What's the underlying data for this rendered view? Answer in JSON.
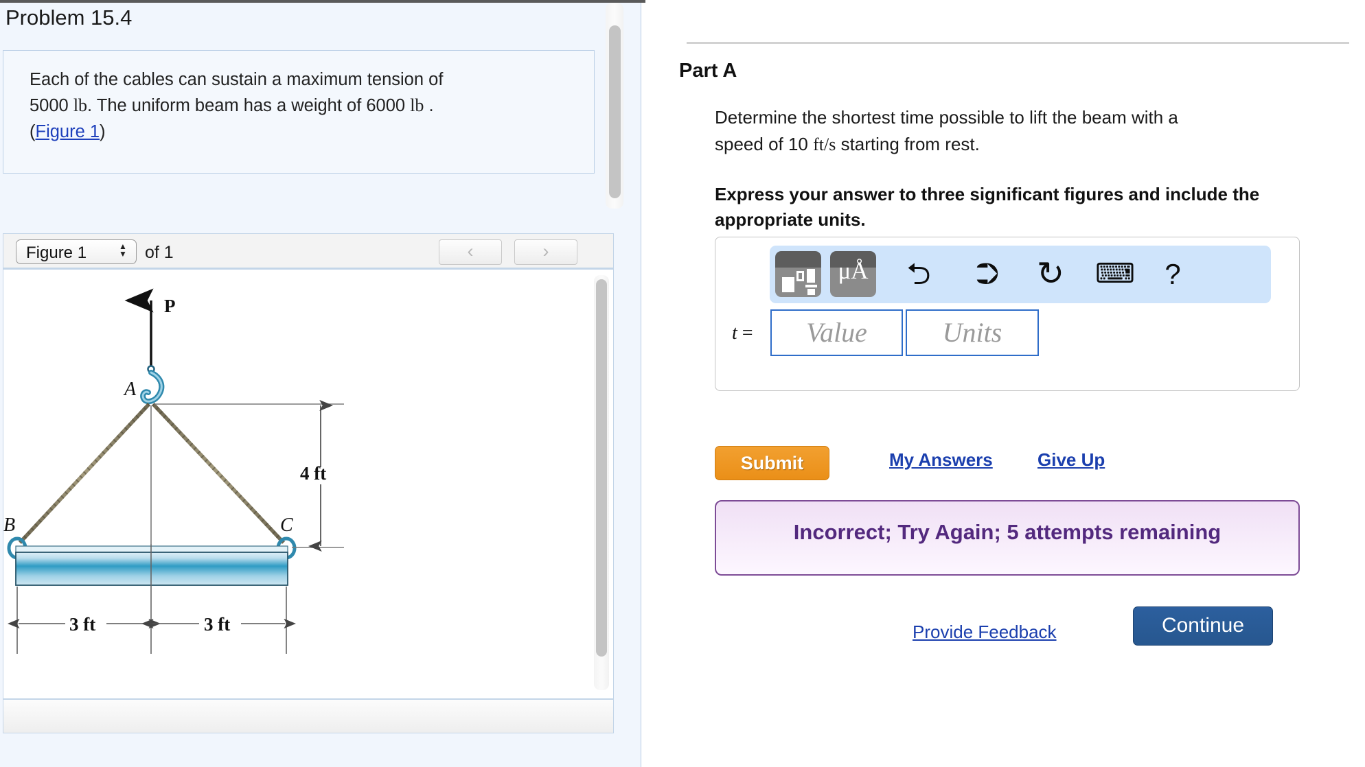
{
  "problem": {
    "title": "Problem 15.4",
    "statement_line1": "Each of the cables can sustain a maximum tension of",
    "statement_line2a": "5000 ",
    "statement_unit1": "lb",
    "statement_line2b": ". The uniform beam has a weight of 6000 ",
    "statement_unit2": "lb",
    "statement_line2c": " .",
    "figure_link": "Figure 1",
    "paren_open": "(",
    "paren_close": ")"
  },
  "figure_widget": {
    "selected_figure": "Figure 1",
    "of_label": "of 1",
    "prev_icon": "chevron-left",
    "next_icon": "chevron-right",
    "prev_glyph": "‹",
    "next_glyph": "›",
    "stepper_up": "▲",
    "stepper_down": "▼"
  },
  "figure_diagram": {
    "force_label": "P",
    "point_a": "A",
    "point_b": "B",
    "point_c": "C",
    "height_dim": "4 ft",
    "left_span_dim": "3 ft",
    "right_span_dim": "3 ft",
    "cable_color": "#8d8466",
    "beam_color_light": "#bfe0ee",
    "beam_color_dark": "#1b7fa8",
    "hook_color": "#2f89ad"
  },
  "part": {
    "title": "Part A",
    "question_line1": "Determine the shortest time possible to lift the beam with a",
    "question_line2a": "speed of 10 ",
    "question_unit": "ft/s",
    "question_line2b": " starting from rest.",
    "instruction": "Express your answer to three significant figures and include the appropriate units."
  },
  "answer": {
    "variable_label": "t",
    "equals": " =",
    "value_placeholder": "Value",
    "units_placeholder": "Units",
    "value_current": "",
    "units_current": ""
  },
  "math_toolbar": {
    "buttons": [
      {
        "name": "template-palette-icon",
        "glyph": ""
      },
      {
        "name": "units-palette-icon",
        "glyph": "μÅ"
      },
      {
        "name": "undo-icon",
        "glyph": "↶"
      },
      {
        "name": "redo-icon",
        "glyph": "↷"
      },
      {
        "name": "reset-icon",
        "glyph": "↻"
      },
      {
        "name": "keyboard-icon",
        "glyph": "⌨"
      },
      {
        "name": "help-icon",
        "glyph": "?"
      }
    ],
    "background_color": "#cfe4fb",
    "mu_symbol": "μ",
    "angstrom_symbol": "Å",
    "undo_glyph": "⮌",
    "redo_glyph": "⮊",
    "reset_glyph": "↻",
    "keyboard_glyph": "⌨",
    "help_glyph": "?"
  },
  "actions": {
    "submit_label": "Submit",
    "my_answers_label": "My Answers",
    "give_up_label": "Give Up",
    "provide_feedback_label": "Provide Feedback",
    "continue_label": "Continue"
  },
  "feedback": {
    "message": "Incorrect; Try Again; 5 attempts remaining",
    "border_color": "#7d4b96",
    "text_color": "#53297e"
  },
  "colors": {
    "panel_background": "#f1f6fd",
    "accent_link": "#1b3fae",
    "submit_orange": "#ea8f18",
    "continue_blue": "#2c5f9e"
  }
}
